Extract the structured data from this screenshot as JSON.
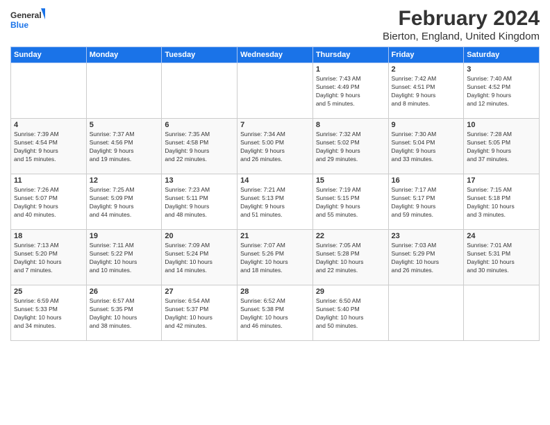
{
  "logo": {
    "general": "General",
    "blue": "Blue"
  },
  "title": "February 2024",
  "location": "Bierton, England, United Kingdom",
  "days_of_week": [
    "Sunday",
    "Monday",
    "Tuesday",
    "Wednesday",
    "Thursday",
    "Friday",
    "Saturday"
  ],
  "weeks": [
    [
      {
        "day": "",
        "info": ""
      },
      {
        "day": "",
        "info": ""
      },
      {
        "day": "",
        "info": ""
      },
      {
        "day": "",
        "info": ""
      },
      {
        "day": "1",
        "info": "Sunrise: 7:43 AM\nSunset: 4:49 PM\nDaylight: 9 hours\nand 5 minutes."
      },
      {
        "day": "2",
        "info": "Sunrise: 7:42 AM\nSunset: 4:51 PM\nDaylight: 9 hours\nand 8 minutes."
      },
      {
        "day": "3",
        "info": "Sunrise: 7:40 AM\nSunset: 4:52 PM\nDaylight: 9 hours\nand 12 minutes."
      }
    ],
    [
      {
        "day": "4",
        "info": "Sunrise: 7:39 AM\nSunset: 4:54 PM\nDaylight: 9 hours\nand 15 minutes."
      },
      {
        "day": "5",
        "info": "Sunrise: 7:37 AM\nSunset: 4:56 PM\nDaylight: 9 hours\nand 19 minutes."
      },
      {
        "day": "6",
        "info": "Sunrise: 7:35 AM\nSunset: 4:58 PM\nDaylight: 9 hours\nand 22 minutes."
      },
      {
        "day": "7",
        "info": "Sunrise: 7:34 AM\nSunset: 5:00 PM\nDaylight: 9 hours\nand 26 minutes."
      },
      {
        "day": "8",
        "info": "Sunrise: 7:32 AM\nSunset: 5:02 PM\nDaylight: 9 hours\nand 29 minutes."
      },
      {
        "day": "9",
        "info": "Sunrise: 7:30 AM\nSunset: 5:04 PM\nDaylight: 9 hours\nand 33 minutes."
      },
      {
        "day": "10",
        "info": "Sunrise: 7:28 AM\nSunset: 5:05 PM\nDaylight: 9 hours\nand 37 minutes."
      }
    ],
    [
      {
        "day": "11",
        "info": "Sunrise: 7:26 AM\nSunset: 5:07 PM\nDaylight: 9 hours\nand 40 minutes."
      },
      {
        "day": "12",
        "info": "Sunrise: 7:25 AM\nSunset: 5:09 PM\nDaylight: 9 hours\nand 44 minutes."
      },
      {
        "day": "13",
        "info": "Sunrise: 7:23 AM\nSunset: 5:11 PM\nDaylight: 9 hours\nand 48 minutes."
      },
      {
        "day": "14",
        "info": "Sunrise: 7:21 AM\nSunset: 5:13 PM\nDaylight: 9 hours\nand 51 minutes."
      },
      {
        "day": "15",
        "info": "Sunrise: 7:19 AM\nSunset: 5:15 PM\nDaylight: 9 hours\nand 55 minutes."
      },
      {
        "day": "16",
        "info": "Sunrise: 7:17 AM\nSunset: 5:17 PM\nDaylight: 9 hours\nand 59 minutes."
      },
      {
        "day": "17",
        "info": "Sunrise: 7:15 AM\nSunset: 5:18 PM\nDaylight: 10 hours\nand 3 minutes."
      }
    ],
    [
      {
        "day": "18",
        "info": "Sunrise: 7:13 AM\nSunset: 5:20 PM\nDaylight: 10 hours\nand 7 minutes."
      },
      {
        "day": "19",
        "info": "Sunrise: 7:11 AM\nSunset: 5:22 PM\nDaylight: 10 hours\nand 10 minutes."
      },
      {
        "day": "20",
        "info": "Sunrise: 7:09 AM\nSunset: 5:24 PM\nDaylight: 10 hours\nand 14 minutes."
      },
      {
        "day": "21",
        "info": "Sunrise: 7:07 AM\nSunset: 5:26 PM\nDaylight: 10 hours\nand 18 minutes."
      },
      {
        "day": "22",
        "info": "Sunrise: 7:05 AM\nSunset: 5:28 PM\nDaylight: 10 hours\nand 22 minutes."
      },
      {
        "day": "23",
        "info": "Sunrise: 7:03 AM\nSunset: 5:29 PM\nDaylight: 10 hours\nand 26 minutes."
      },
      {
        "day": "24",
        "info": "Sunrise: 7:01 AM\nSunset: 5:31 PM\nDaylight: 10 hours\nand 30 minutes."
      }
    ],
    [
      {
        "day": "25",
        "info": "Sunrise: 6:59 AM\nSunset: 5:33 PM\nDaylight: 10 hours\nand 34 minutes."
      },
      {
        "day": "26",
        "info": "Sunrise: 6:57 AM\nSunset: 5:35 PM\nDaylight: 10 hours\nand 38 minutes."
      },
      {
        "day": "27",
        "info": "Sunrise: 6:54 AM\nSunset: 5:37 PM\nDaylight: 10 hours\nand 42 minutes."
      },
      {
        "day": "28",
        "info": "Sunrise: 6:52 AM\nSunset: 5:38 PM\nDaylight: 10 hours\nand 46 minutes."
      },
      {
        "day": "29",
        "info": "Sunrise: 6:50 AM\nSunset: 5:40 PM\nDaylight: 10 hours\nand 50 minutes."
      },
      {
        "day": "",
        "info": ""
      },
      {
        "day": "",
        "info": ""
      }
    ]
  ]
}
